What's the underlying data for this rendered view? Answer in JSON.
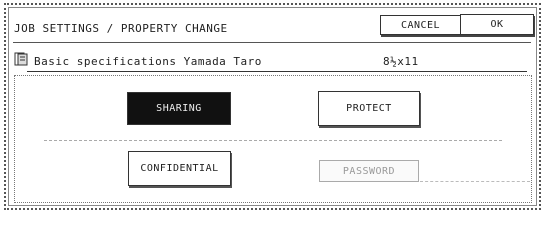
{
  "window": {
    "title": "JOB SETTINGS / PROPERTY CHANGE",
    "cancel_label": "CANCEL",
    "ok_label": "OK"
  },
  "file": {
    "icon": "document-icon",
    "name": "Basic specifications Yamada Taro",
    "paper_size": "8½x11"
  },
  "options": {
    "sharing": "SHARING",
    "protect": "PROTECT",
    "confidential": "CONFIDENTIAL",
    "password": "PASSWORD"
  },
  "colors": {
    "selected_bg": "#111111",
    "disabled_text": "#999999"
  }
}
